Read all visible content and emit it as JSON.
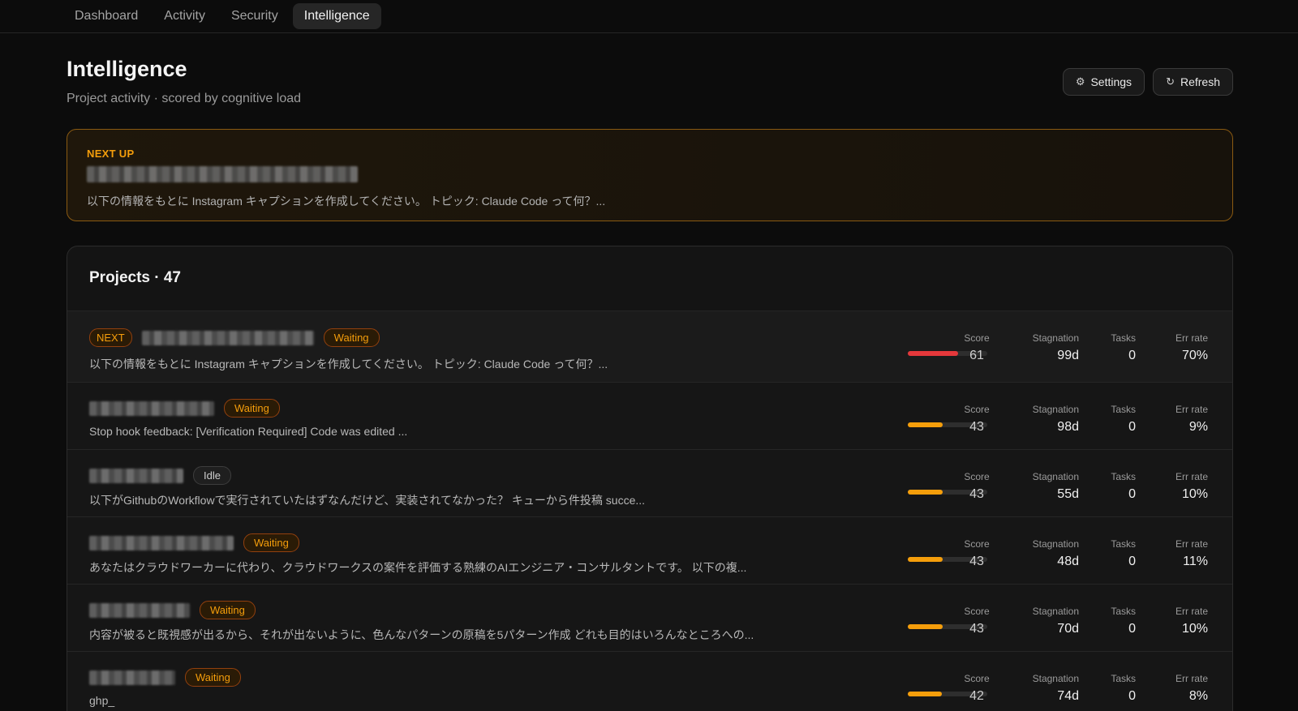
{
  "nav": {
    "tabs": [
      {
        "label": "Dashboard"
      },
      {
        "label": "Activity"
      },
      {
        "label": "Security"
      },
      {
        "label": "Intelligence"
      }
    ]
  },
  "header": {
    "title": "Intelligence",
    "subtitle": "Project activity · scored by cognitive load",
    "settings_label": "Settings",
    "refresh_label": "Refresh"
  },
  "next_up": {
    "label": "NEXT UP",
    "description": "以下の情報をもとに Instagram キャプションを作成してください。 トピック: Claude Code って何？..."
  },
  "projects": {
    "title": "Projects · 47",
    "metric_labels": {
      "score": "Score",
      "stagnation": "Stagnation",
      "tasks": "Tasks",
      "err": "Err rate"
    },
    "rows": [
      {
        "next_badge": "NEXT",
        "status": "Waiting",
        "status_type": "waiting",
        "description": "以下の情報をもとに Instagram キャプションを作成してください。 トピック: Claude Code って何？...",
        "score": "61",
        "score_fraction": 0.63,
        "bar_color": "#e5383b",
        "stagnation": "99d",
        "tasks": "0",
        "err": "70%"
      },
      {
        "status": "Waiting",
        "status_type": "waiting",
        "description": "Stop hook feedback: [Verification Required] Code was edited ...",
        "score": "43",
        "score_fraction": 0.44,
        "bar_color": "#f59e0b",
        "stagnation": "98d",
        "tasks": "0",
        "err": "9%"
      },
      {
        "status": "Idle",
        "status_type": "idle",
        "description": "以下がGithubのWorkflowで実行されていたはずなんだけど、実装されてなかった？ キューから件投稿 succe...",
        "score": "43",
        "score_fraction": 0.44,
        "bar_color": "#f59e0b",
        "stagnation": "55d",
        "tasks": "0",
        "err": "10%"
      },
      {
        "status": "Waiting",
        "status_type": "waiting",
        "description": "あなたはクラウドワーカーに代わり、クラウドワークスの案件を評価する熟練のAIエンジニア・コンサルタントです。 以下の複...",
        "score": "43",
        "score_fraction": 0.44,
        "bar_color": "#f59e0b",
        "stagnation": "48d",
        "tasks": "0",
        "err": "11%"
      },
      {
        "status": "Waiting",
        "status_type": "waiting",
        "description": "内容が被ると既視感が出るから、それが出ないように、色んなパターンの原稿を5パターン作成 どれも目的はいろんなところへの...",
        "score": "43",
        "score_fraction": 0.44,
        "bar_color": "#f59e0b",
        "stagnation": "70d",
        "tasks": "0",
        "err": "10%"
      },
      {
        "status": "Waiting",
        "status_type": "waiting",
        "description": "ghp_",
        "score": "42",
        "score_fraction": 0.43,
        "bar_color": "#f59e0b",
        "stagnation": "74d",
        "tasks": "0",
        "err": "8%"
      }
    ]
  }
}
